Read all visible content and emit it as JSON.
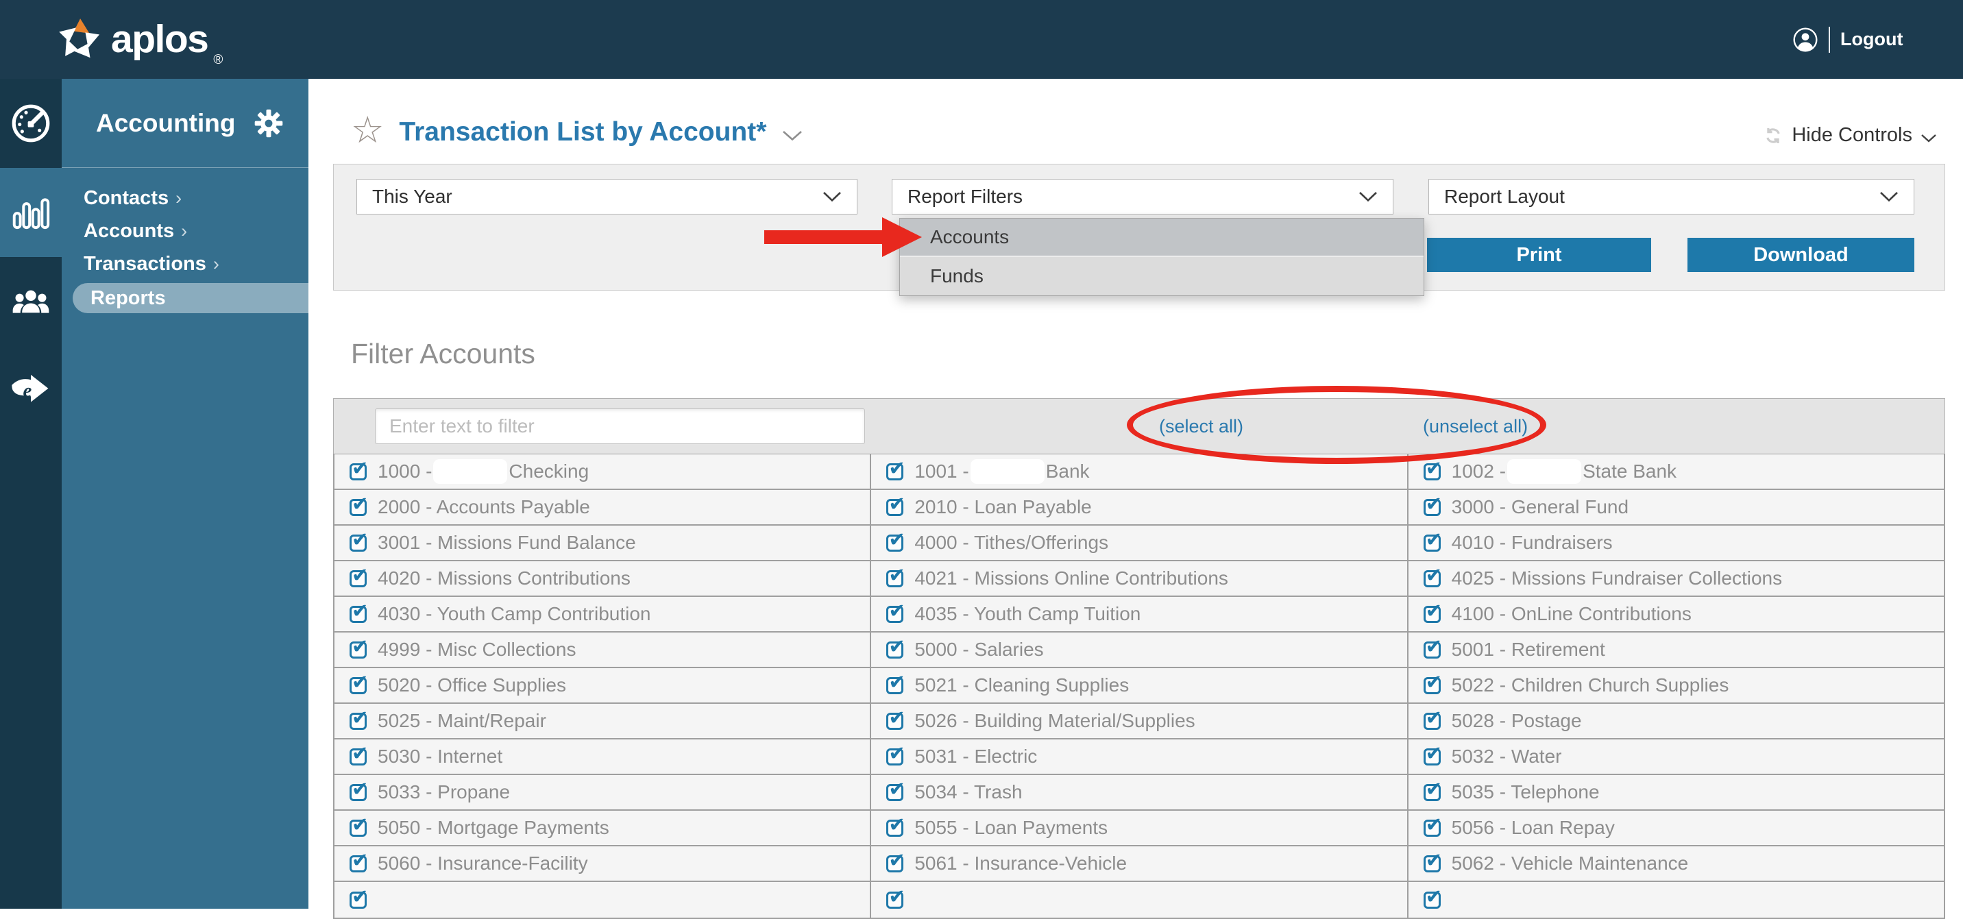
{
  "colors": {
    "topbar": "#1c3b4f",
    "rail": "#17384a",
    "panel_blue": "#356f8e",
    "pill": "#8aacbe",
    "accent_blue": "#2a79ae",
    "button_blue": "#1e79aa",
    "annotation_red": "#e8281e",
    "checkbox_blue": "#1e78a9",
    "text_gray": "#8d8d8d"
  },
  "topbar": {
    "logo_text": "aplos",
    "logo_reg_mark": "®",
    "logout_label": "Logout"
  },
  "sidebar": {
    "module_title": "Accounting",
    "rail_icons": [
      "dashboard-gauge-icon",
      "bar-chart-icon (active)",
      "people-icon",
      "efile-arrow-icon"
    ],
    "items": [
      {
        "label": "Contacts",
        "has_arrow": true,
        "active": false
      },
      {
        "label": "Accounts",
        "has_arrow": true,
        "active": false
      },
      {
        "label": "Transactions",
        "has_arrow": true,
        "active": false
      },
      {
        "label": "Reports",
        "has_arrow": false,
        "active": true
      }
    ]
  },
  "report_header": {
    "title": "Transaction List by Account*",
    "hide_controls_label": "Hide Controls"
  },
  "controls": {
    "date_range": "This Year",
    "report_filters": "Report Filters",
    "report_layout": "Report Layout",
    "print_label": "Print",
    "download_label": "Download",
    "filters_menu": {
      "options": [
        {
          "label": "Accounts",
          "highlighted": true
        },
        {
          "label": "Funds",
          "highlighted": false
        }
      ]
    }
  },
  "annotations": {
    "color": "#e8281e",
    "arrow_points_at": "Accounts menu option",
    "ellipse_circles": "(select all) and (unselect all) links"
  },
  "filter_section": {
    "heading": "Filter Accounts",
    "filter_placeholder": "Enter text to filter",
    "select_all_label": "(select all)",
    "unselect_all_label": "(unselect all)",
    "all_checked": true,
    "rows": [
      {
        "cells": [
          {
            "redacted": true,
            "pre": "1000 - ",
            "post": "Checking"
          },
          {
            "redacted": true,
            "pre": "1001 - ",
            "post": "Bank"
          },
          {
            "redacted": true,
            "pre": "1002 - ",
            "post": "State Bank"
          }
        ]
      },
      {
        "cells": [
          {
            "text": "2000 - Accounts Payable"
          },
          {
            "text": "2010 - Loan Payable"
          },
          {
            "text": "3000 - General Fund"
          }
        ]
      },
      {
        "cells": [
          {
            "text": "3001 - Missions Fund Balance"
          },
          {
            "text": "4000 - Tithes/Offerings"
          },
          {
            "text": "4010 - Fundraisers"
          }
        ]
      },
      {
        "cells": [
          {
            "text": "4020 - Missions Contributions"
          },
          {
            "text": "4021 - Missions Online Contributions"
          },
          {
            "text": "4025 - Missions Fundraiser Collections"
          }
        ]
      },
      {
        "cells": [
          {
            "text": "4030 - Youth Camp Contribution"
          },
          {
            "text": "4035 - Youth Camp Tuition"
          },
          {
            "text": "4100 - OnLine Contributions"
          }
        ]
      },
      {
        "cells": [
          {
            "text": "4999 - Misc Collections"
          },
          {
            "text": "5000 - Salaries"
          },
          {
            "text": "5001 - Retirement"
          }
        ]
      },
      {
        "cells": [
          {
            "text": "5020 - Office Supplies"
          },
          {
            "text": "5021 - Cleaning Supplies"
          },
          {
            "text": "5022 - Children Church Supplies"
          }
        ]
      },
      {
        "cells": [
          {
            "text": "5025 - Maint/Repair"
          },
          {
            "text": "5026 - Building Material/Supplies"
          },
          {
            "text": "5028 - Postage"
          }
        ]
      },
      {
        "cells": [
          {
            "text": "5030 - Internet"
          },
          {
            "text": "5031 - Electric"
          },
          {
            "text": "5032 - Water"
          }
        ]
      },
      {
        "cells": [
          {
            "text": "5033 - Propane"
          },
          {
            "text": "5034 - Trash"
          },
          {
            "text": "5035 - Telephone"
          }
        ]
      },
      {
        "cells": [
          {
            "text": "5050 - Mortgage Payments"
          },
          {
            "text": "5055 - Loan Payments"
          },
          {
            "text": "5056 - Loan Repay"
          }
        ]
      },
      {
        "cells": [
          {
            "text": "5060 - Insurance-Facility"
          },
          {
            "text": "5061 - Insurance-Vehicle"
          },
          {
            "text": "5062 - Vehicle Maintenance"
          }
        ]
      },
      {
        "clipped": true,
        "cells": [
          {
            "text": ""
          },
          {
            "text": ""
          },
          {
            "text": ""
          }
        ]
      }
    ]
  }
}
